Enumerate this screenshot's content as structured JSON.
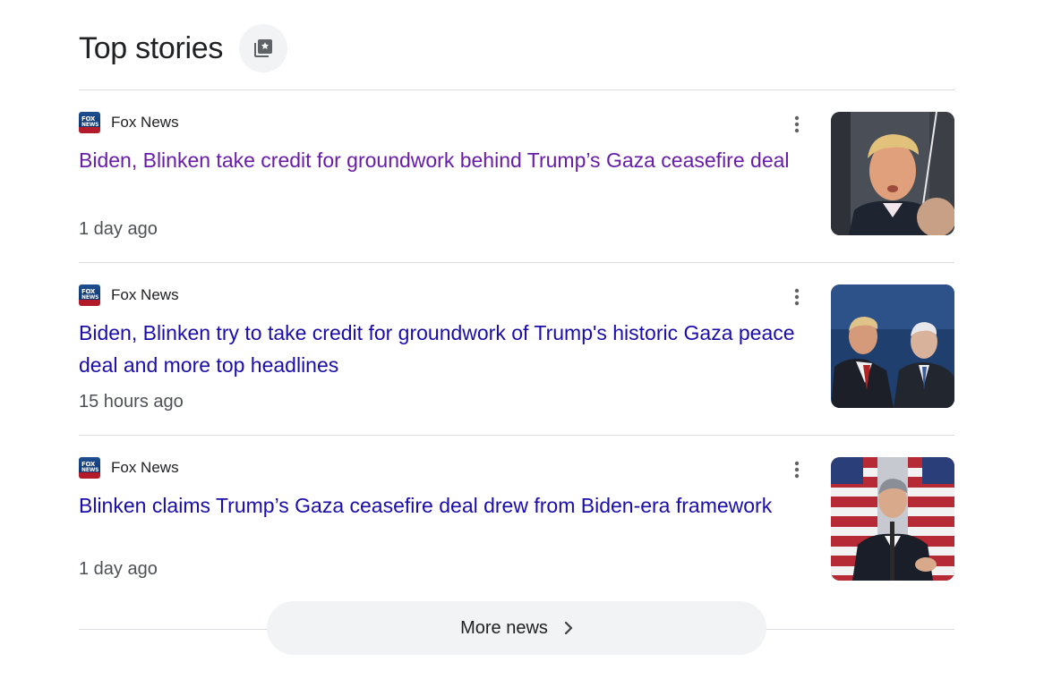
{
  "section": {
    "title": "Top stories"
  },
  "stories": [
    {
      "source": "Fox News",
      "headline": "Biden, Blinken take credit for groundwork behind Trump’s Gaza ceasefire deal",
      "time": "1 day ago",
      "visited": true
    },
    {
      "source": "Fox News",
      "headline": "Biden, Blinken try to take credit for groundwork of Trump's historic Gaza peace deal and more top headlines",
      "time": "15 hours ago",
      "visited": false
    },
    {
      "source": "Fox News",
      "headline": "Blinken claims Trump’s Gaza ceasefire deal drew from Biden-era framework",
      "time": "1 day ago",
      "visited": false
    }
  ],
  "more_news": {
    "label": "More news"
  },
  "colors": {
    "visited_link": "#681da8",
    "link": "#1a0dab",
    "text": "#202124",
    "muted": "#4d5156",
    "divider": "#dadce0",
    "button_bg": "#f1f3f4"
  },
  "icons": {
    "header_button": "saved-stories-icon",
    "menu": "more-vert-icon",
    "more_news": "chevron-right-icon"
  }
}
